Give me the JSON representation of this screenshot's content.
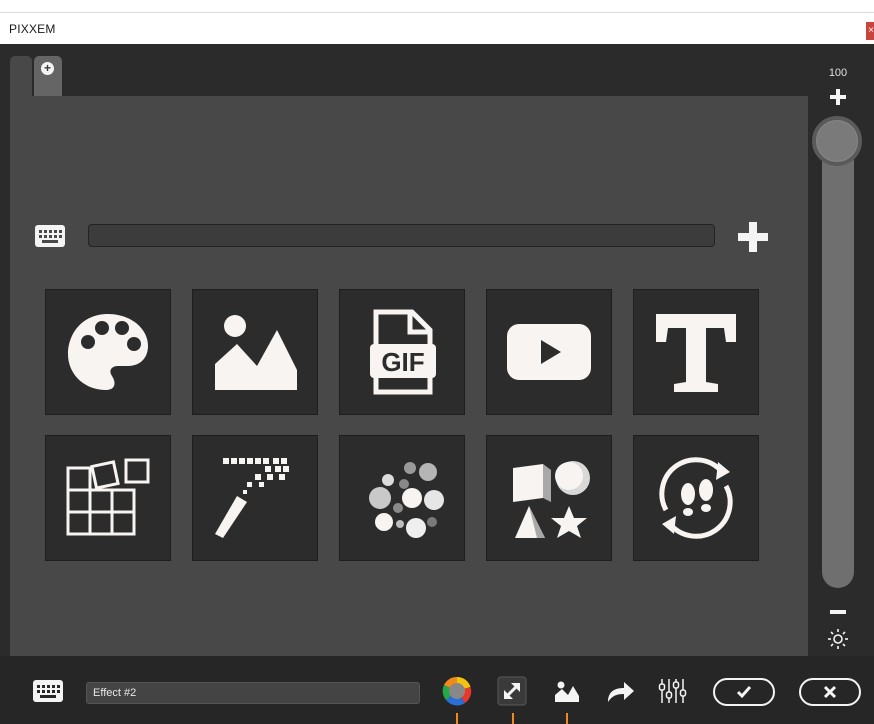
{
  "window": {
    "title": "PIXXEM",
    "close_glyph": "×"
  },
  "tabs": {
    "add_glyph": "+"
  },
  "editor": {
    "effect_input_value": "",
    "tiles_row1": [
      "palette-icon",
      "image-icon",
      "gif-file-icon",
      "video-play-icon",
      "text-icon"
    ],
    "tiles_row2": [
      "mosaic-icon",
      "pixel-wand-icon",
      "particles-icon",
      "shapes-icon",
      "footsteps-loop-icon"
    ],
    "gif_label": "GIF"
  },
  "slider": {
    "value_label": "100",
    "value": 100
  },
  "bottom_bar": {
    "effect_name": "Effect #2"
  },
  "colors": {
    "accent_orange": "#f08a1a",
    "close_red": "#c9453b",
    "icon_white": "#f7f4f2"
  }
}
